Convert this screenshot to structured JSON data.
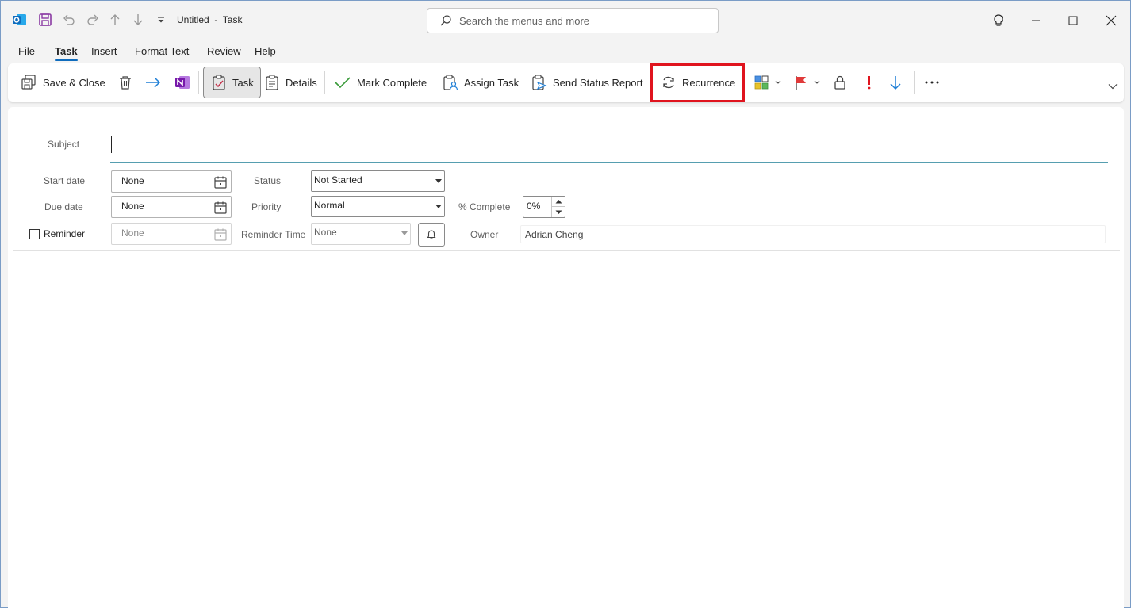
{
  "titlebar": {
    "title": "Untitled  -  Task",
    "search_placeholder": "Search the menus and more"
  },
  "menu_tabs": [
    "File",
    "Task",
    "Insert",
    "Format Text",
    "Review",
    "Help"
  ],
  "active_tab": "Task",
  "ribbon": {
    "save_close": "Save & Close",
    "task": "Task",
    "details": "Details",
    "mark_complete": "Mark Complete",
    "assign_task": "Assign Task",
    "send_status_report": "Send Status Report",
    "recurrence": "Recurrence"
  },
  "form": {
    "subject_label": "Subject",
    "subject_value": "",
    "start_date_label": "Start date",
    "start_date_value": "None",
    "due_date_label": "Due date",
    "due_date_value": "None",
    "reminder_label": "Reminder",
    "reminder_date_value": "None",
    "status_label": "Status",
    "status_value": "Not Started",
    "priority_label": "Priority",
    "priority_value": "Normal",
    "reminder_time_label": "Reminder Time",
    "reminder_time_value": "None",
    "percent_complete_label": "% Complete",
    "percent_complete_value": "0%",
    "owner_label": "Owner",
    "owner_value": "Adrian Cheng"
  },
  "colors": {
    "accent": "#0f6cbd",
    "highlight_border": "#e0141e",
    "outlook_blue": "#0f6cbd",
    "onenote_purple": "#7719aa",
    "save_purple": "#8a3aa3"
  }
}
